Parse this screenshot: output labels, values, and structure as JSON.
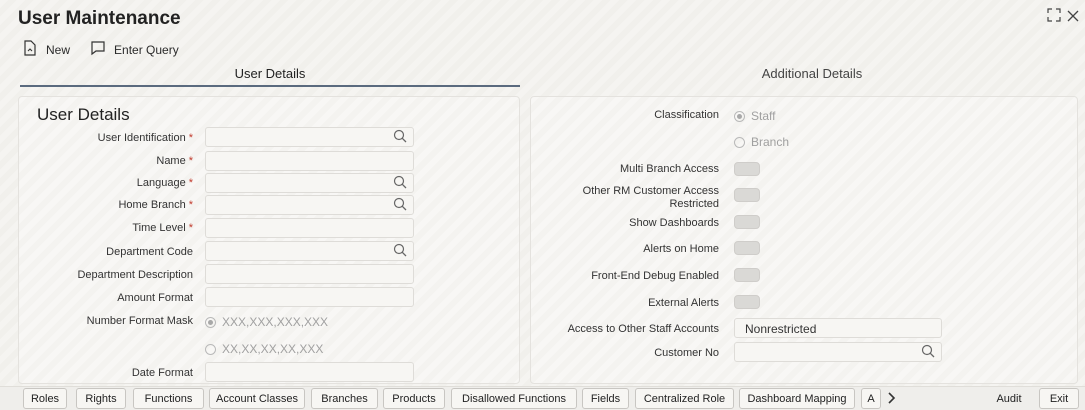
{
  "window": {
    "title": "User Maintenance"
  },
  "toolbar": {
    "new_label": "New",
    "enter_query_label": "Enter Query"
  },
  "tabs": [
    {
      "label": "User Details"
    },
    {
      "label": "Additional Details"
    }
  ],
  "user_details": {
    "section_title": "User Details",
    "fields": {
      "user_identification": {
        "label": "User Identification",
        "value": ""
      },
      "name": {
        "label": "Name",
        "value": ""
      },
      "language": {
        "label": "Language",
        "value": ""
      },
      "home_branch": {
        "label": "Home Branch",
        "value": ""
      },
      "time_level": {
        "label": "Time Level",
        "value": ""
      },
      "department_code": {
        "label": "Department Code",
        "value": ""
      },
      "department_description": {
        "label": "Department Description",
        "value": ""
      },
      "amount_format": {
        "label": "Amount Format",
        "value": ""
      },
      "number_format_mask": {
        "label": "Number Format Mask",
        "options": [
          "XXX,XXX,XXX,XXX",
          "XX,XX,XX,XX,XXX"
        ],
        "selected": "XXX,XXX,XXX,XXX"
      },
      "date_format": {
        "label": "Date Format",
        "value": ""
      }
    },
    "required_marker": "*"
  },
  "additional": {
    "classification": {
      "label": "Classification",
      "options": [
        "Staff",
        "Branch"
      ],
      "selected": "Staff"
    },
    "multi_branch_access": {
      "label": "Multi Branch Access",
      "on": false
    },
    "other_rm_customer_access_restricted": {
      "label": "Other RM Customer Access Restricted",
      "on": false
    },
    "show_dashboards": {
      "label": "Show Dashboards",
      "on": false
    },
    "alerts_on_home": {
      "label": "Alerts on Home",
      "on": false
    },
    "front_end_debug_enabled": {
      "label": "Front-End Debug Enabled",
      "on": false
    },
    "external_alerts": {
      "label": "External Alerts",
      "on": false
    },
    "access_to_other_staff_accounts": {
      "label": "Access to Other Staff Accounts",
      "value": "Nonrestricted"
    },
    "customer_no": {
      "label": "Customer No",
      "value": ""
    }
  },
  "bottom_tabs": [
    {
      "label": "Roles"
    },
    {
      "label": "Rights"
    },
    {
      "label": "Functions"
    },
    {
      "label": "Account Classes"
    },
    {
      "label": "Branches"
    },
    {
      "label": "Products"
    },
    {
      "label": "Disallowed Functions"
    },
    {
      "label": "Fields"
    },
    {
      "label": "Centralized Role"
    },
    {
      "label": "Dashboard Mapping"
    },
    {
      "label": "A"
    }
  ],
  "bottom_actions": {
    "audit_label": "Audit",
    "exit_label": "Exit"
  },
  "colors": {
    "accent": "#5a6a7e",
    "required": "#c0392b"
  }
}
